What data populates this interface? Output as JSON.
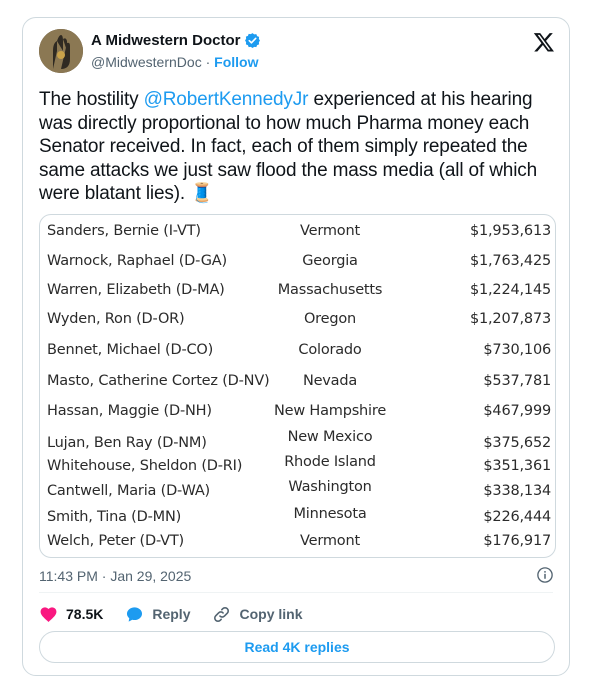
{
  "author": {
    "name": "A Midwestern Doctor",
    "handle": "@MidwesternDoc",
    "separator": "·",
    "follow_label": "Follow"
  },
  "tweet": {
    "text_before": "The hostility ",
    "mention": "@RobertKennedyJr",
    "text_after": " experienced at his hearing was directly proportional to how much Pharma money each Senator received. In fact, each of them simply repeated the same attacks we just saw flood the mass media (all of which were blatant lies). ",
    "emoji": "🧵"
  },
  "media_table": {
    "rows": [
      {
        "name": "Sanders, Bernie (I-VT)",
        "state": "Vermont",
        "amount": "$1,953,613"
      },
      {
        "name": "Warnock, Raphael (D-GA)",
        "state": "Georgia",
        "amount": "$1,763,425"
      },
      {
        "name": "Warren, Elizabeth (D-MA)",
        "state": "Massachusetts",
        "amount": "$1,224,145"
      },
      {
        "name": "Wyden, Ron (D-OR)",
        "state": "Oregon",
        "amount": "$1,207,873"
      },
      {
        "name": "Bennet, Michael (D-CO)",
        "state": "Colorado",
        "amount": "$730,106"
      },
      {
        "name": "Masto, Catherine Cortez (D-NV)",
        "state": "Nevada",
        "amount": "$537,781"
      },
      {
        "name": "Hassan, Maggie (D-NH)",
        "state": "New Hampshire",
        "amount": "$467,999"
      },
      {
        "name": "Lujan, Ben Ray (D-NM)",
        "state": "New Mexico",
        "amount": "$375,652"
      },
      {
        "name": "Whitehouse, Sheldon (D-RI)",
        "state": "Rhode Island",
        "amount": "$351,361"
      },
      {
        "name": "Cantwell, Maria (D-WA)",
        "state": "Washington",
        "amount": "$338,134"
      },
      {
        "name": "Smith, Tina (D-MN)",
        "state": "Minnesota",
        "amount": "$226,444"
      },
      {
        "name": "Welch, Peter (D-VT)",
        "state": "Vermont",
        "amount": "$176,917"
      }
    ]
  },
  "timestamp": "11:43 PM · Jan 29, 2025",
  "actions": {
    "likes": "78.5K",
    "reply_label": "Reply",
    "copy_link_label": "Copy link"
  },
  "read_replies_label": "Read 4K replies",
  "colors": {
    "accent": "#1d9bf0",
    "like": "#f91880",
    "muted": "#536471",
    "border": "#cfd9de"
  },
  "icons": [
    "verified-badge-icon",
    "x-logo-icon",
    "info-icon",
    "heart-icon",
    "reply-icon",
    "link-icon"
  ]
}
